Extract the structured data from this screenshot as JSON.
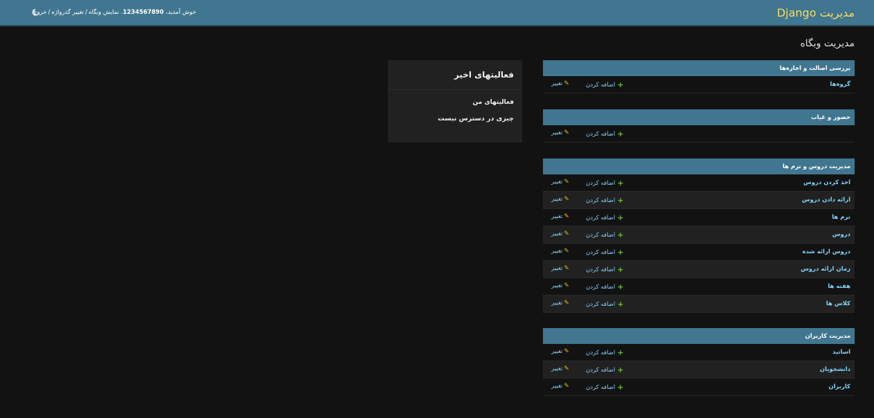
{
  "header": {
    "branding": "مدیریت Django",
    "welcome": "خوش آمدید،",
    "username": "1234567890",
    "view_site": "نمایش وبگاه",
    "change_password": "تغییر گذرواژه",
    "logout": "خروج",
    "separator": "/",
    "theme_icon": "moon-icon"
  },
  "page_title": "مدیریت وبگاه",
  "colors": {
    "header_bg": "#417690",
    "branding": "#f5dd5d",
    "link": "#81d4fa",
    "add_icon": "#70bf2b",
    "change_icon": "#efb80b",
    "body_bg": "#121212"
  },
  "actions": {
    "add": "اضافه کردن",
    "change": "تغییر"
  },
  "modules": [
    {
      "caption": "بررسی اصالت و اجازه‌ها",
      "models": [
        "گروه‌ها"
      ]
    },
    {
      "caption": "حضور و غیاب",
      "models": [
        ""
      ]
    },
    {
      "caption": "مدیریت دروس و ترم ها",
      "models": [
        "اخذ کردن دروس",
        "ارائه دادن دروس",
        "ترم ها",
        "دروس",
        "دروس ارائه شده",
        "زمان ارائه دروس",
        "هفته ها",
        "کلاس ها"
      ]
    },
    {
      "caption": "مدیریت کاربران",
      "models": [
        "اساتید",
        "دانشجویان",
        "کاربران"
      ]
    }
  ],
  "recent_actions": {
    "title": "فعالیتهای اخیر",
    "my_actions": "فعالیتهای من",
    "none_available": "چیزی در دسترس نیست"
  }
}
